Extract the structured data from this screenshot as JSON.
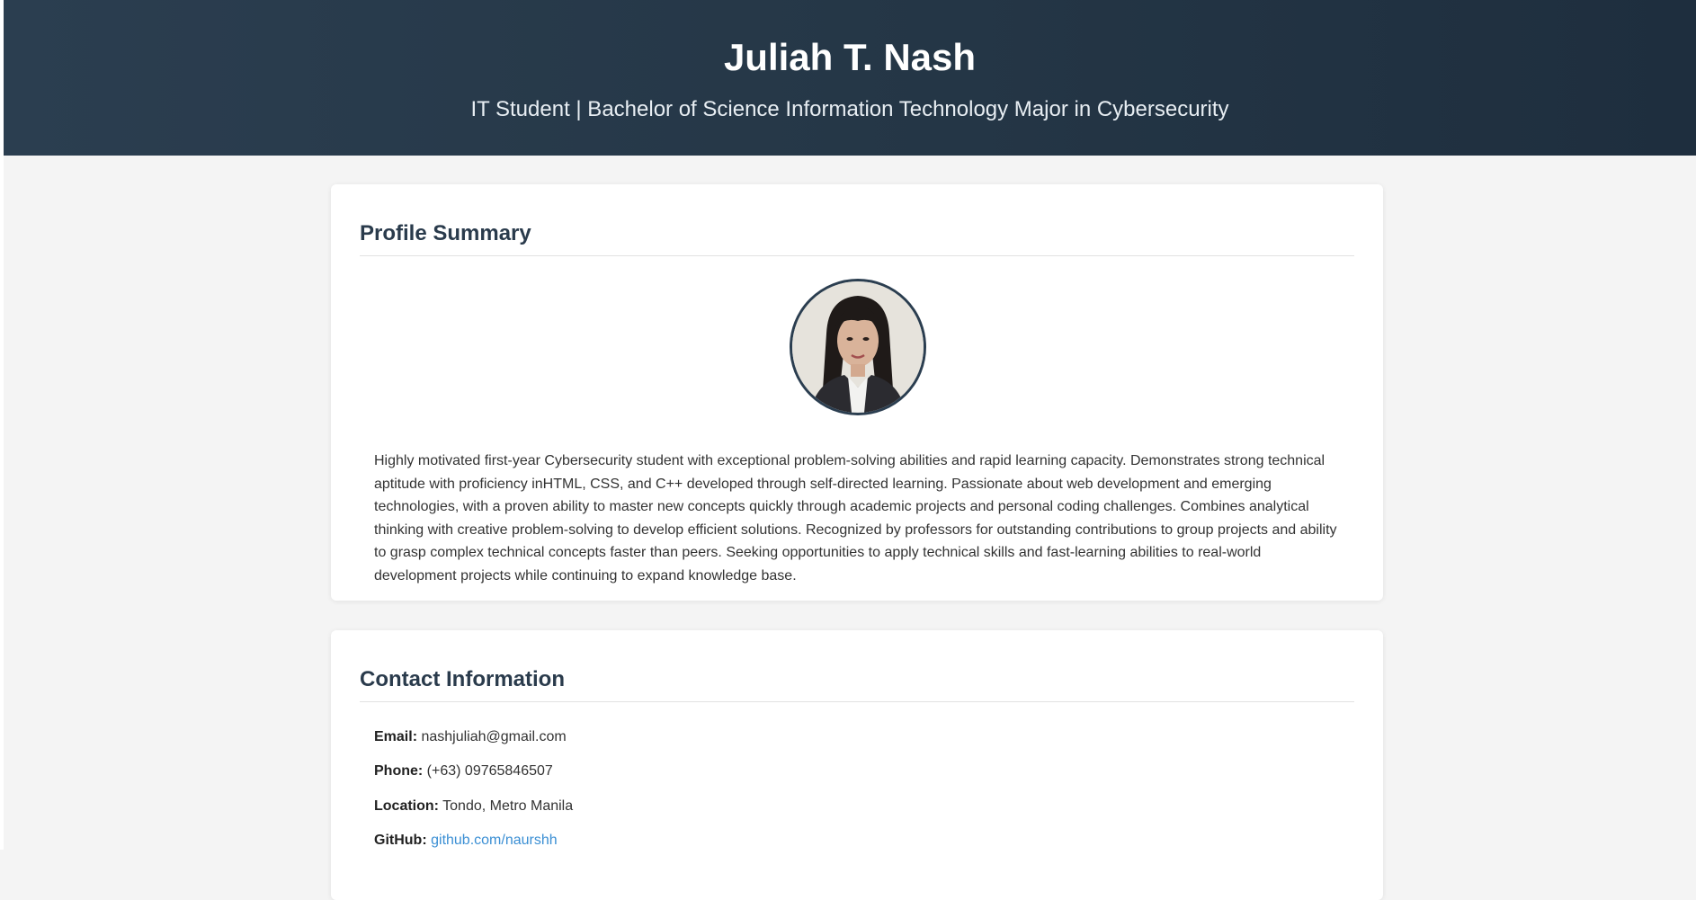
{
  "header": {
    "name": "Juliah T. Nash",
    "subtitle": "IT Student | Bachelor of Science Information Technology Major in Cybersecurity"
  },
  "profile": {
    "heading": "Profile Summary",
    "summary": "Highly motivated first-year Cybersecurity student with exceptional problem-solving abilities and rapid learning capacity. Demonstrates strong technical aptitude with proficiency inHTML, CSS, and C++ developed through self-directed learning. Passionate about web development and emerging technologies, with a proven ability to master new concepts quickly through academic projects and personal coding challenges. Combines analytical thinking with creative problem-solving to develop efficient solutions. Recognized by professors for outstanding contributions to group projects and ability to grasp complex technical concepts faster than peers. Seeking opportunities to apply technical skills and fast-learning abilities to real-world development projects while continuing to expand knowledge base."
  },
  "contact": {
    "heading": "Contact Information",
    "email_label": "Email:",
    "email_value": "nashjuliah@gmail.com",
    "phone_label": "Phone:",
    "phone_value": "(+63) 09765846507",
    "location_label": "Location:",
    "location_value": "Tondo, Metro Manila",
    "github_label": "GitHub:",
    "github_value": "github.com/naurshh"
  },
  "colors": {
    "header_bg": "#253747",
    "heading_text": "#2a3b4c",
    "link": "#3b8fd4",
    "page_bg": "#f4f4f4"
  }
}
